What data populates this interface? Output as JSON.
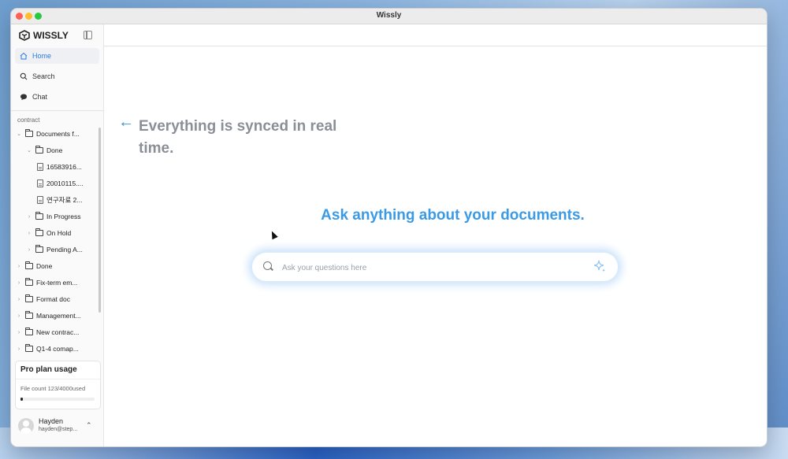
{
  "window": {
    "title": "Wissly"
  },
  "sidebar": {
    "logo_text": "WISSLY",
    "nav": [
      {
        "label": "Home",
        "icon": "home-icon",
        "active": true
      },
      {
        "label": "Search",
        "icon": "search-icon"
      },
      {
        "label": "Chat",
        "icon": "chat-icon"
      }
    ],
    "section_label": "contract",
    "tree": [
      {
        "label": "Documents f...",
        "type": "folder",
        "expanded": true
      },
      {
        "label": "Done",
        "type": "folder",
        "expanded": true
      },
      {
        "label": "16583916...",
        "type": "file"
      },
      {
        "label": "20010115....",
        "type": "file"
      },
      {
        "label": "연구자료 2...",
        "type": "file"
      },
      {
        "label": "In Progress",
        "type": "folder"
      },
      {
        "label": "On Hold",
        "type": "folder"
      },
      {
        "label": "Pending A...",
        "type": "folder"
      },
      {
        "label": "Done",
        "type": "folder"
      },
      {
        "label": "Fix-term em...",
        "type": "folder"
      },
      {
        "label": "Format doc",
        "type": "folder"
      },
      {
        "label": "Management...",
        "type": "folder"
      },
      {
        "label": "New contrac...",
        "type": "folder"
      },
      {
        "label": "Q1-4 comap...",
        "type": "folder"
      }
    ],
    "usage": {
      "title": "Pro plan usage",
      "text": "File count 123/4000used",
      "fraction": 0.03
    },
    "user": {
      "name": "Hayden",
      "email": "hayden@step..."
    }
  },
  "main": {
    "hint": "Everything is synced in real time.",
    "headline": "Ask anything about your documents.",
    "search_placeholder": "Ask your questions here"
  },
  "colors": {
    "accent": "#3b9ae6",
    "hint_text": "#8a8f97"
  }
}
